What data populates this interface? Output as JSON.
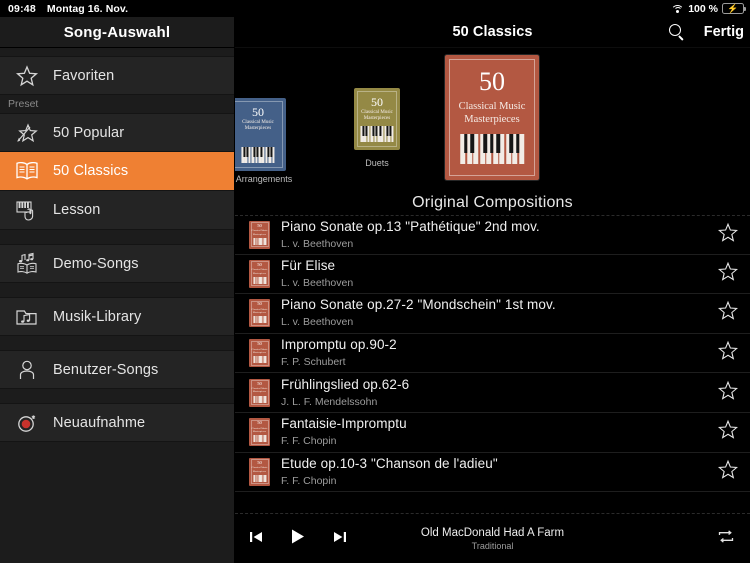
{
  "statusbar": {
    "time": "09:48",
    "date": "Montag 16. Nov.",
    "wifi_icon": "wifi-icon",
    "battery_percent": "100 %",
    "battery_icon": "battery-charging-icon"
  },
  "sidebar": {
    "title": "Song-Auswahl",
    "group_label": "Preset",
    "items": [
      {
        "label": "Favoriten",
        "icon": "star-icon",
        "active": false
      },
      {
        "label": "50 Popular",
        "icon": "shooting-star-icon",
        "active": false
      },
      {
        "label": "50 Classics",
        "icon": "open-book-icon",
        "active": true
      },
      {
        "label": "Lesson",
        "icon": "piano-hand-icon",
        "active": false
      },
      {
        "label": "Demo-Songs",
        "icon": "music-book-icon",
        "active": false
      },
      {
        "label": "Musik-Library",
        "icon": "music-folder-icon",
        "active": false
      },
      {
        "label": "Benutzer-Songs",
        "icon": "user-icon",
        "active": false
      },
      {
        "label": "Neuaufnahme",
        "icon": "record-icon",
        "active": false
      }
    ]
  },
  "topbar": {
    "title": "50 Classics",
    "search_icon": "search-icon",
    "done_label": "Fertig"
  },
  "carousel": {
    "selected_title": "Original Compositions",
    "covers": [
      {
        "caption": "Arrangements",
        "number": "50",
        "line1": "Classical Music",
        "line2": "Masterpieces",
        "color": "#3f618f"
      },
      {
        "caption": "Duets",
        "number": "50",
        "line1": "Classical Music",
        "line2": "Masterpieces",
        "color": "#97893a"
      },
      {
        "caption": "",
        "number": "50",
        "line1": "Classical Music",
        "line2": "Masterpieces",
        "color": "#b35842"
      }
    ]
  },
  "songs": [
    {
      "title": "Piano Sonate op.13 \"Pathétique\" 2nd mov.",
      "artist": "L. v. Beethoven",
      "favorite": false
    },
    {
      "title": "Für Elise",
      "artist": "L. v. Beethoven",
      "favorite": false
    },
    {
      "title": "Piano Sonate op.27-2 \"Mondschein\" 1st mov.",
      "artist": "L. v. Beethoven",
      "favorite": false
    },
    {
      "title": "Impromptu op.90-2",
      "artist": "F. P. Schubert",
      "favorite": false
    },
    {
      "title": "Frühlingslied op.62-6",
      "artist": "J. L. F. Mendelssohn",
      "favorite": false
    },
    {
      "title": "Fantaisie-Impromptu",
      "artist": "F. F. Chopin",
      "favorite": false
    },
    {
      "title": "Etude op.10-3 \"Chanson de l'adieu\"",
      "artist": "F. F. Chopin",
      "favorite": false
    }
  ],
  "thumb": {
    "number": "50",
    "line1": "Classical Music",
    "line2": "Masterpieces",
    "color": "#b35842"
  },
  "transport": {
    "prev_icon": "skip-previous-icon",
    "play_icon": "play-icon",
    "next_icon": "skip-next-icon",
    "repeat_icon": "repeat-icon",
    "now_playing_title": "Old MacDonald Had A Farm",
    "now_playing_artist": "Traditional"
  },
  "colors": {
    "accent": "#ef8033",
    "sidebar_bg": "#1c1c1c",
    "row_bg": "#242424",
    "main_bg": "#000000",
    "cover_red": "#b35842",
    "cover_blue": "#3f618f",
    "cover_gold": "#97893a",
    "battery_green": "#4cd964"
  }
}
